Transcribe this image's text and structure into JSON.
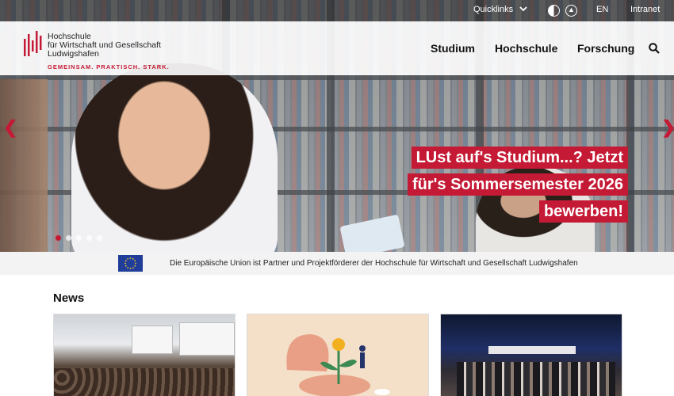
{
  "topbar": {
    "quicklinks": "Quicklinks",
    "language": "EN",
    "intranet": "Intranet"
  },
  "header": {
    "logo_line1": "Hochschule",
    "logo_line2": "für Wirtschaft und Gesellschaft",
    "logo_line3": "Ludwigshafen",
    "logo_slogan": "GEMEINSAM. PRAKTISCH. STARK.",
    "nav": [
      "Studium",
      "Hochschule",
      "Forschung"
    ]
  },
  "hero": {
    "slogan_line1": "LUst auf's Studium...? Jetzt",
    "slogan_line2": "für's Sommersemester 2026",
    "slogan_line3": "bewerben!",
    "slide_count": 5,
    "active_slide": 1
  },
  "eu_banner": {
    "text": "Die Europäische Union ist Partner und Projektförderer der Hochschule für Wirtschaft und Gesellschaft Ludwigshafen"
  },
  "news": {
    "title": "News"
  },
  "colors": {
    "brand_red": "#c51a35",
    "eu_blue": "#1f3d99"
  }
}
